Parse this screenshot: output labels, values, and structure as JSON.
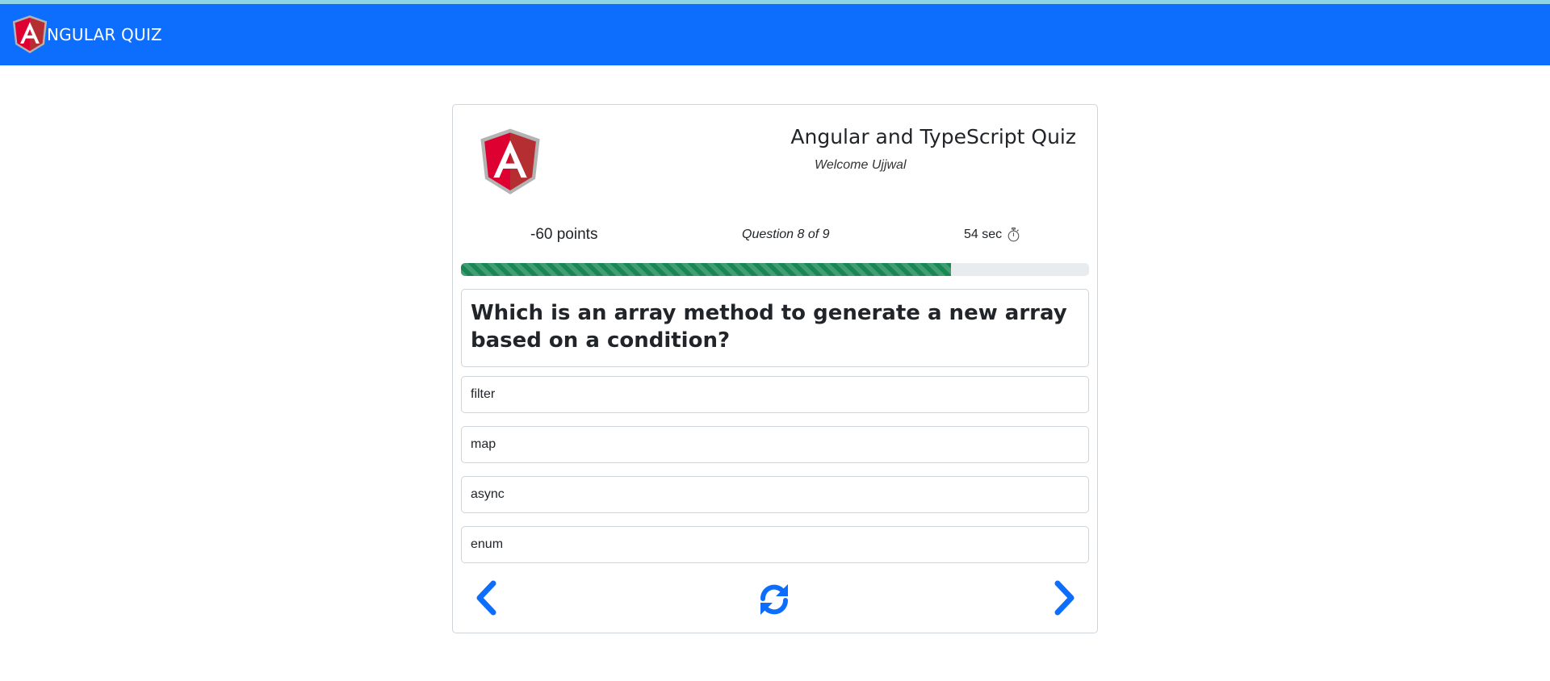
{
  "navbar": {
    "brand_text": "NGULAR QUIZ",
    "brand_color": "#0d6efd"
  },
  "quiz": {
    "title": "Angular and TypeScript Quiz",
    "welcome": "Welcome Ujjwal",
    "points": "-60 points",
    "question_count": "Question 8 of 9",
    "timer": "54 sec",
    "progress_percent": 78,
    "progress_color": "#198754",
    "question": "Which is an array method to generate a new array based on a condition?",
    "options": [
      "filter",
      "map",
      "async",
      "enum"
    ]
  },
  "icons": {
    "logo": "angular-shield-icon",
    "timer": "stopwatch-icon",
    "prev": "chevron-left-icon",
    "refresh": "refresh-icon",
    "next": "chevron-right-icon"
  }
}
